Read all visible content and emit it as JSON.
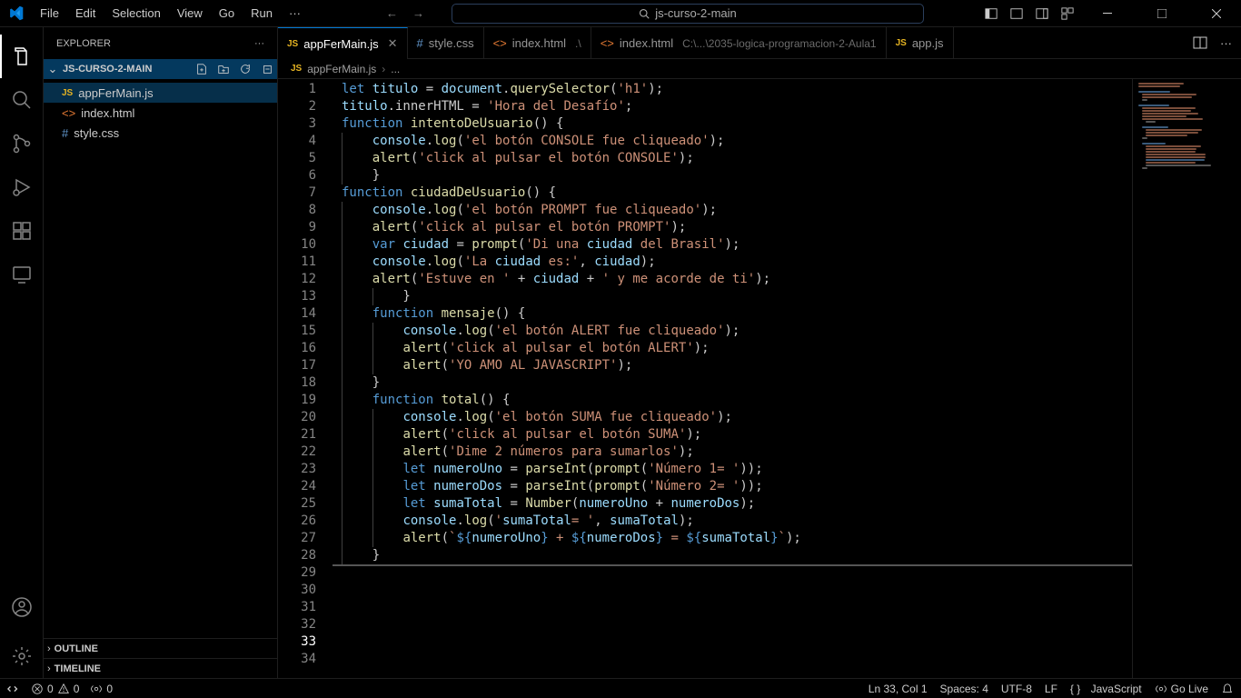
{
  "menu": [
    "File",
    "Edit",
    "Selection",
    "View",
    "Go",
    "Run",
    "···"
  ],
  "search_text": "js-curso-2-main",
  "explorer": {
    "title": "EXPLORER",
    "workspace": "JS-CURSO-2-MAIN",
    "files": [
      {
        "name": "appFerMain.js",
        "icon": "js",
        "selected": true
      },
      {
        "name": "index.html",
        "icon": "html",
        "selected": false
      },
      {
        "name": "style.css",
        "icon": "css",
        "selected": false
      }
    ],
    "outline": "OUTLINE",
    "timeline": "TIMELINE"
  },
  "tabs": [
    {
      "label": "appFerMain.js",
      "icon": "js",
      "active": true,
      "close": true
    },
    {
      "label": "style.css",
      "icon": "css",
      "active": false
    },
    {
      "label": "index.html",
      "icon": "html",
      "dim": ".\\",
      "active": false
    },
    {
      "label": "index.html",
      "icon": "html",
      "dim": "C:\\...\\2035-logica-programacion-2-Aula1",
      "active": false
    },
    {
      "label": "app.js",
      "icon": "js",
      "active": false
    }
  ],
  "breadcrumb": {
    "icon": "js",
    "file": "appFerMain.js",
    "rest": "..."
  },
  "code_lines": [
    "let titulo = document.querySelector('h1');",
    "titulo.innerHTML = 'Hora del Desafío';",
    "",
    "function intentoDeUsuario() {",
    "    console.log('el botón CONSOLE fue cliqueado');",
    "    alert('click al pulsar el botón CONSOLE');",
    "    }",
    "",
    "function ciudadDeUsuario() {",
    "    console.log('el botón PROMPT fue cliqueado');",
    "    alert('click al pulsar el botón PROMPT');",
    "    var ciudad = prompt('Di una ciudad del Brasil');",
    "    console.log('La ciudad es:', ciudad);",
    "    alert('Estuve en ' + ciudad + ' y me acorde de ti');",
    "        }",
    "",
    "    function mensaje() {",
    "        console.log('el botón ALERT fue cliqueado');",
    "        alert('click al pulsar el botón ALERT');",
    "        alert('YO AMO AL JAVASCRIPT');",
    "    }",
    "",
    "    function total() {",
    "        console.log('el botón SUMA fue cliqueado');",
    "        alert('click al pulsar el botón SUMA');",
    "        alert('Dime 2 números para sumarlos');",
    "        let numeroUno = parseInt(prompt('Número 1= '));",
    "        let numeroDos = parseInt(prompt('Número 2= '));",
    "        let sumaTotal = Number(numeroUno + numeroDos);",
    "        console.log('sumaTotal= ', sumaTotal);",
    "        alert(`${numeroUno} + ${numeroDos} = ${sumaTotal}`);",
    "    }",
    "",
    ""
  ],
  "current_line": 33,
  "status": {
    "remote": "",
    "errors": "0",
    "warnings": "0",
    "port": "0",
    "ln_col": "Ln 33, Col 1",
    "spaces": "Spaces: 4",
    "encoding": "UTF-8",
    "eol": "LF",
    "lang": "JavaScript",
    "golive": "Go Live"
  }
}
